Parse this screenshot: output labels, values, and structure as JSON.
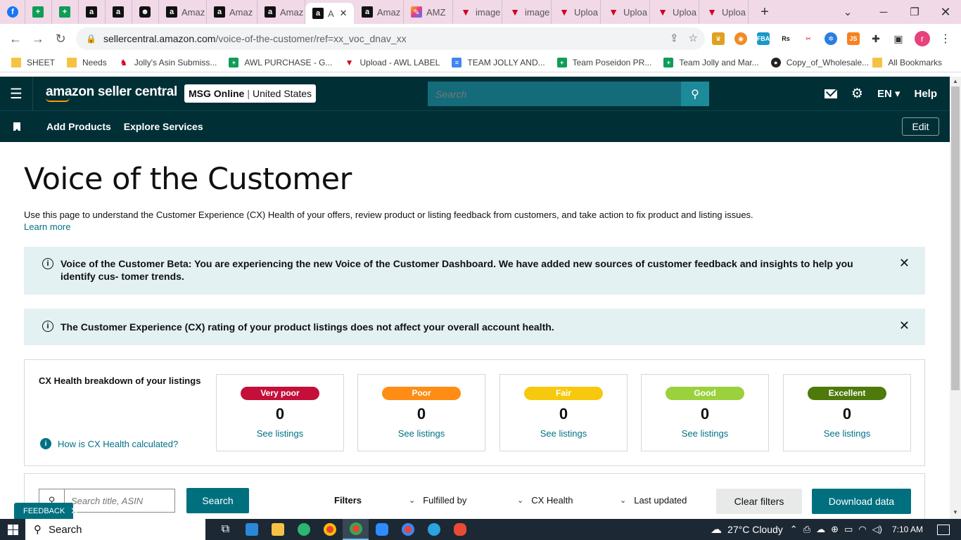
{
  "browser": {
    "tabs": [
      {
        "icon": "facebook",
        "title": ""
      },
      {
        "icon": "sheets",
        "title": ""
      },
      {
        "icon": "sheets",
        "title": ""
      },
      {
        "icon": "amazon",
        "title": ""
      },
      {
        "icon": "amazon",
        "title": ""
      },
      {
        "icon": "mturk",
        "title": ""
      },
      {
        "icon": "amazon",
        "title": "Amaz"
      },
      {
        "icon": "amazon",
        "title": "Amaz"
      },
      {
        "icon": "amazon",
        "title": "Amaz"
      },
      {
        "icon": "amazon",
        "title": "A",
        "active": true
      },
      {
        "icon": "amazon",
        "title": "Amaz"
      },
      {
        "icon": "claude",
        "title": "AMZ"
      },
      {
        "icon": "vm",
        "title": "image"
      },
      {
        "icon": "vm",
        "title": "image"
      },
      {
        "icon": "vm",
        "title": "Uploa"
      },
      {
        "icon": "vm",
        "title": "Uploa"
      },
      {
        "icon": "vm",
        "title": "Uploa"
      },
      {
        "icon": "vm",
        "title": "Uploa"
      }
    ],
    "url_host": "sellercentral.amazon.com",
    "url_path": "/voice-of-the-customer/ref=xx_voc_dnav_xx",
    "profile_initial": "r",
    "bookmarks": [
      {
        "icon": "folder",
        "label": "SHEET"
      },
      {
        "icon": "folder",
        "label": "Needs"
      },
      {
        "icon": "vm",
        "label": "Jolly's Asin Submiss..."
      },
      {
        "icon": "sheet",
        "label": "AWL PURCHASE - G..."
      },
      {
        "icon": "vm",
        "label": "Upload - AWL LABEL"
      },
      {
        "icon": "doc",
        "label": "TEAM JOLLY AND..."
      },
      {
        "icon": "sheet",
        "label": "Team Poseidon PR..."
      },
      {
        "icon": "sheet",
        "label": "Team Jolly and Mar..."
      },
      {
        "icon": "github",
        "label": "Copy_of_Wholesale..."
      }
    ],
    "all_bookmarks": "All Bookmarks"
  },
  "header": {
    "logo_text": "amazon seller central",
    "account_name": "MSG Online",
    "account_region": "United States",
    "search_placeholder": "Search",
    "language": "EN",
    "help": "Help",
    "subnav": [
      "Add Products",
      "Explore Services"
    ],
    "edit": "Edit"
  },
  "page": {
    "title": "Voice of the Customer",
    "intro": "Use this page to understand the Customer Experience (CX) Health of your offers, review product or listing feedback from customers, and take action to fix product and listing issues.",
    "learn_more": "Learn more",
    "alerts": [
      "Voice of the Customer Beta: You are experiencing the new Voice of the Customer Dashboard. We have added new sources of customer feedback and insights to help you identify cus- tomer trends.",
      "The Customer Experience (CX) rating of your product listings does not affect your overall account health."
    ],
    "cx_title": "CX Health breakdown of your listings",
    "cx_how": "How is CX Health calculated?",
    "cx_cards": [
      {
        "label": "Very poor",
        "count": "0",
        "link": "See listings",
        "color": "#c40f3a"
      },
      {
        "label": "Poor",
        "count": "0",
        "link": "See listings",
        "color": "#ff8c14"
      },
      {
        "label": "Fair",
        "count": "0",
        "link": "See listings",
        "color": "#f6c90e"
      },
      {
        "label": "Good",
        "count": "0",
        "link": "See listings",
        "color": "#9ad13c"
      },
      {
        "label": "Excellent",
        "count": "0",
        "link": "See listings",
        "color": "#4d7a0a"
      }
    ],
    "filters": {
      "search_placeholder": "Search title, ASIN",
      "search_button": "Search",
      "label": "Filters",
      "dropdowns": [
        "Fulfilled by",
        "CX Health",
        "Last updated"
      ],
      "clear": "Clear filters",
      "download": "Download data"
    },
    "feedback": "FEEDBACK"
  },
  "taskbar": {
    "search": "Search",
    "weather": "27°C  Cloudy",
    "time": "7:10 AM"
  }
}
